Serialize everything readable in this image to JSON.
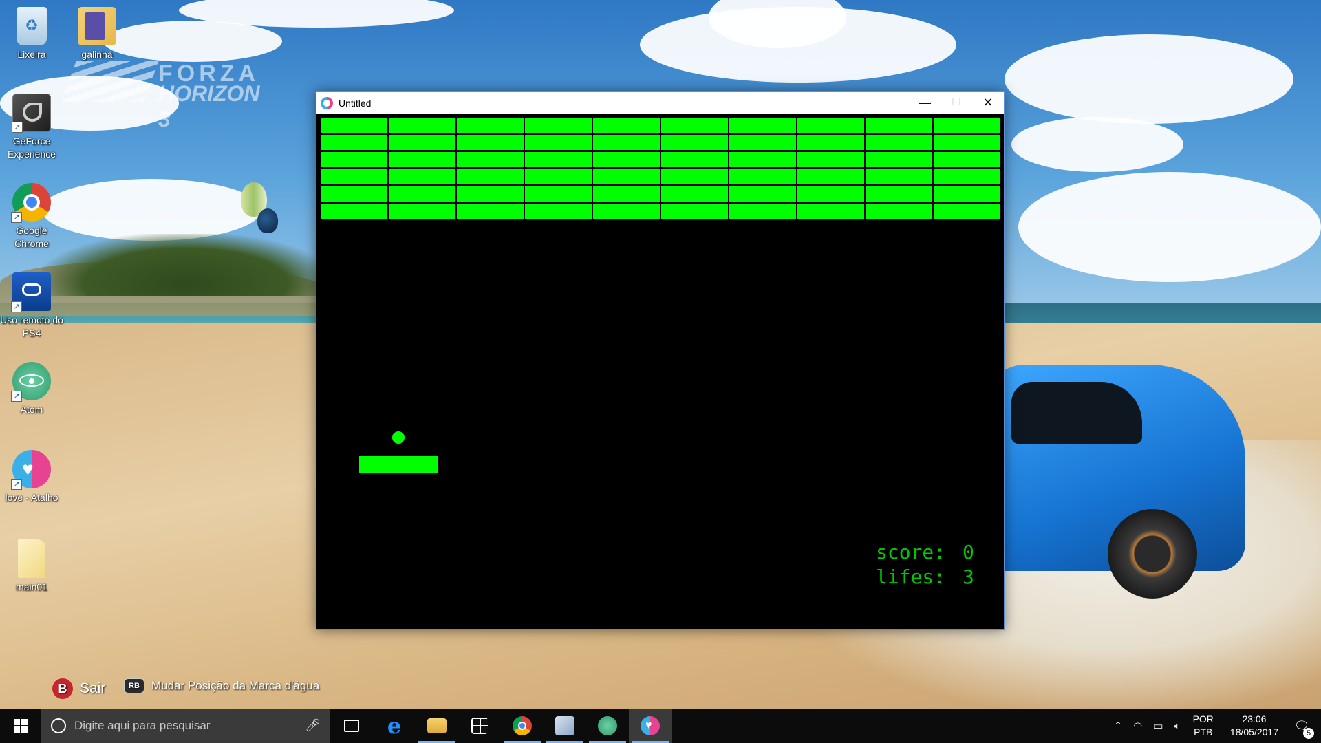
{
  "desktop": {
    "icons": [
      {
        "label": "Lixeira",
        "icon": "recycle-bin-icon"
      },
      {
        "label": "galinha",
        "icon": "folder-icon"
      },
      {
        "label": "GeForce Experience",
        "icon": "geforce-icon"
      },
      {
        "label": "Google Chrome",
        "icon": "chrome-icon"
      },
      {
        "label": "Uso remoto do PS4",
        "icon": "ps4-remote-icon"
      },
      {
        "label": "Atom",
        "icon": "atom-icon"
      },
      {
        "label": "love - Atalho",
        "icon": "love-icon"
      },
      {
        "label": "main01",
        "icon": "file-icon"
      }
    ],
    "watermark": {
      "line1": "FORZA",
      "line2": "HORIZON 3"
    },
    "game_hints": {
      "b_button": "B",
      "b_label": "Sair",
      "rb_button": "RB",
      "rb_label": "Mudar Posição da Marca d'água"
    }
  },
  "window": {
    "title": "Untitled",
    "controls": {
      "minimize": "—",
      "maximize": "☐",
      "close": "✕"
    },
    "game": {
      "brick_rows": 6,
      "brick_cols": 10,
      "color": "#00ff00",
      "hud_color": "#00c800",
      "score_label": "score:",
      "score_value": "0",
      "lifes_label": "lifes:",
      "lifes_value": "3"
    }
  },
  "taskbar": {
    "search_placeholder": "Digite aqui para pesquisar",
    "apps": [
      {
        "name": "task-view-icon",
        "active": false
      },
      {
        "name": "edge-icon",
        "active": false
      },
      {
        "name": "file-explorer-icon",
        "active": true
      },
      {
        "name": "store-icon",
        "active": false
      },
      {
        "name": "chrome-icon",
        "active": true
      },
      {
        "name": "photos-icon",
        "active": true
      },
      {
        "name": "atom-icon",
        "active": true
      },
      {
        "name": "love-icon",
        "active": true
      }
    ],
    "tray": {
      "lang_line1": "POR",
      "lang_line2": "PTB",
      "time": "23:06",
      "date": "18/05/2017",
      "notification_count": "5"
    }
  }
}
